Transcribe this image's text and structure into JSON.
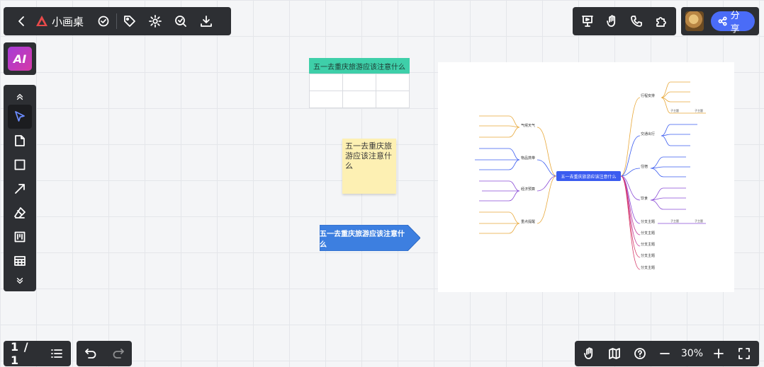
{
  "app": {
    "name": "小画桌",
    "share_label": "分享",
    "ai_label": "AI"
  },
  "top_left_toolbar": {
    "icons": [
      "back-icon",
      "logo-icon",
      "check-circle-icon",
      "tag-icon",
      "settings-icon",
      "ai-assist-icon",
      "download-icon"
    ]
  },
  "top_right_toolbar": {
    "icons": [
      "presentation-icon",
      "hand-raise-icon",
      "phone-icon",
      "plugin-icon"
    ]
  },
  "left_tools": {
    "icons": [
      "collapse-up-icon",
      "select-pointer-icon",
      "sticky-note-icon",
      "rectangle-icon",
      "arrow-line-icon",
      "eraser-icon",
      "frame-icon",
      "table-icon",
      "expand-down-icon"
    ],
    "active": "select-pointer-icon"
  },
  "bottom_left": {
    "page_indicator": "1 / 1"
  },
  "bottom_right": {
    "zoom_level": "30%",
    "icons": [
      "hand-icon",
      "map-icon",
      "help-icon",
      "zoom-out-icon",
      "zoom-in-icon",
      "fullscreen-icon"
    ]
  },
  "canvas": {
    "table_title": "五一去重庆旅游应该注意什么",
    "sticky_text": "五一去重庆旅游应该注意什么",
    "arrow_text": "五一去重庆旅游应该注意什么",
    "mindmap": {
      "center": "五一去重庆旅游应该注意什么",
      "right_branches": [
        "行程安排",
        "交通出行",
        "住宿",
        "饮食",
        "分支主题",
        "分支主题",
        "分支主题",
        "分支主题",
        "分支主题"
      ],
      "left_branches": [
        "气候天气",
        "物品携带",
        "经济预算",
        "重点提醒"
      ],
      "leaf_text": "子主题"
    },
    "colors": {
      "table_header": "#3ecfa9",
      "sticky": "#fdf0b3",
      "arrow": "#3d7fe0",
      "mindmap_center": "#3b5cf0",
      "share_button": "#4a6cf7"
    }
  }
}
